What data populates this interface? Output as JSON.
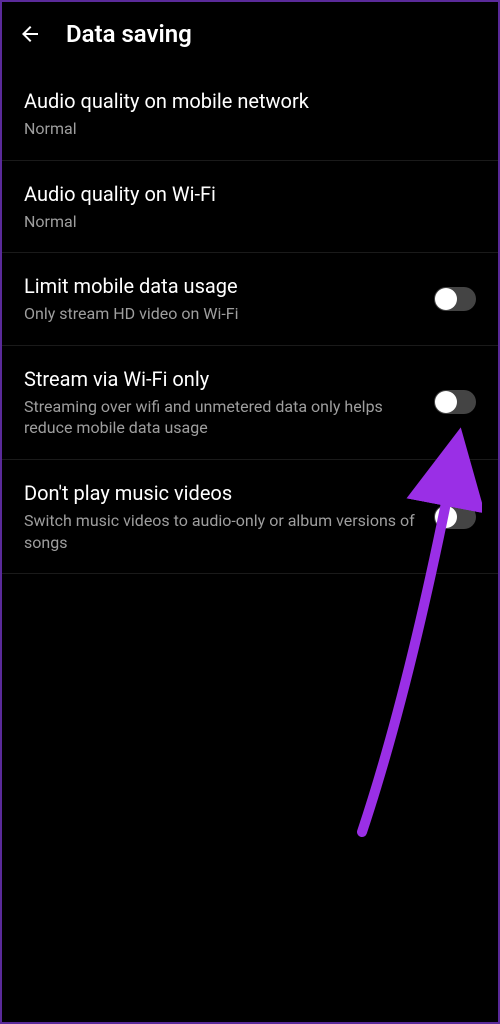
{
  "header": {
    "title": "Data saving"
  },
  "settings": [
    {
      "title": "Audio quality on mobile network",
      "subtitle": "Normal",
      "hasToggle": false
    },
    {
      "title": "Audio quality on Wi-Fi",
      "subtitle": "Normal",
      "hasToggle": false
    },
    {
      "title": "Limit mobile data usage",
      "subtitle": "Only stream HD video on Wi-Fi",
      "hasToggle": true,
      "toggleState": false
    },
    {
      "title": "Stream via Wi-Fi only",
      "subtitle": "Streaming over wifi and unmetered data only helps reduce mobile data usage",
      "hasToggle": true,
      "toggleState": false
    },
    {
      "title": "Don't play music videos",
      "subtitle": "Switch music videos to audio-only or album versions of songs",
      "hasToggle": true,
      "toggleState": false
    }
  ],
  "annotation": {
    "color": "#9a2fe6"
  }
}
